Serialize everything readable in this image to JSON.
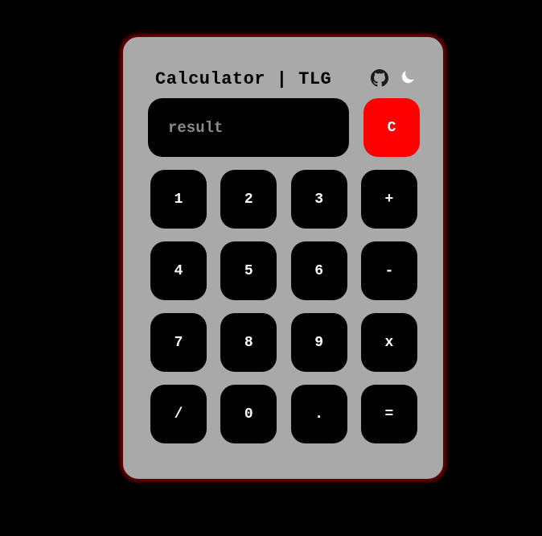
{
  "app": {
    "title": "Calculator | TLG"
  },
  "header": {
    "icons": [
      {
        "name": "github-icon"
      },
      {
        "name": "moon-icon"
      }
    ]
  },
  "display": {
    "value": "",
    "placeholder": "result"
  },
  "clear": {
    "label": "C"
  },
  "keys": [
    "1",
    "2",
    "3",
    "+",
    "4",
    "5",
    "6",
    "-",
    "7",
    "8",
    "9",
    "x",
    "/",
    "0",
    ".",
    "="
  ],
  "colors": {
    "background": "#000000",
    "panel": "#a9a9a9",
    "key": "#000000",
    "clear": "#ff0000",
    "glow": "#be0000"
  }
}
